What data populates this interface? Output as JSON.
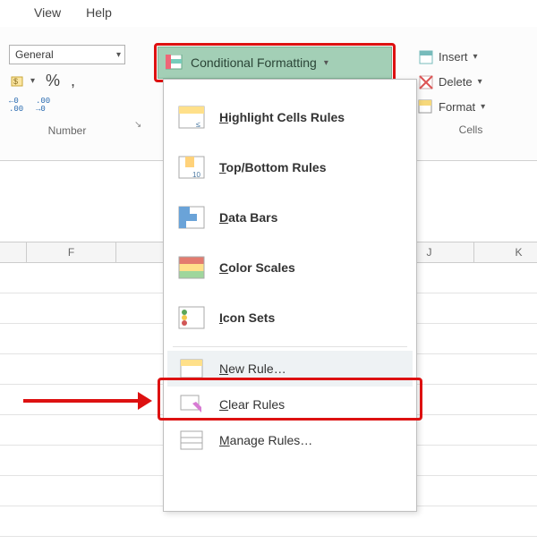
{
  "menubar": {
    "view": "View",
    "help": "Help"
  },
  "number_group": {
    "format_value": "General",
    "group_label": "Number",
    "accounting_tip": "Accounting",
    "percent": "%",
    "comma": ",",
    "dec_inc": "←0 .00",
    "dec_dec": ".00 →0"
  },
  "cf_button": {
    "label": "Conditional Formatting"
  },
  "cells_group": {
    "insert": "Insert",
    "delete": "Delete",
    "format": "Format",
    "group_label": "Cells"
  },
  "columns": [
    "F",
    "",
    "",
    "J",
    "K"
  ],
  "cf_menu": {
    "highlight": "Highlight Cells Rules",
    "topbottom": "Top/Bottom Rules",
    "databars": "Data Bars",
    "colorscales": "Color Scales",
    "iconsets": "Icon Sets",
    "newrule": "New Rule…",
    "clear": "Clear Rules",
    "manage": "Manage Rules…",
    "ul": {
      "h": "H",
      "t": "T",
      "d": "D",
      "c_scale": "C",
      "i": "I",
      "n": "N",
      "c_clear": "C",
      "m": "M"
    }
  }
}
